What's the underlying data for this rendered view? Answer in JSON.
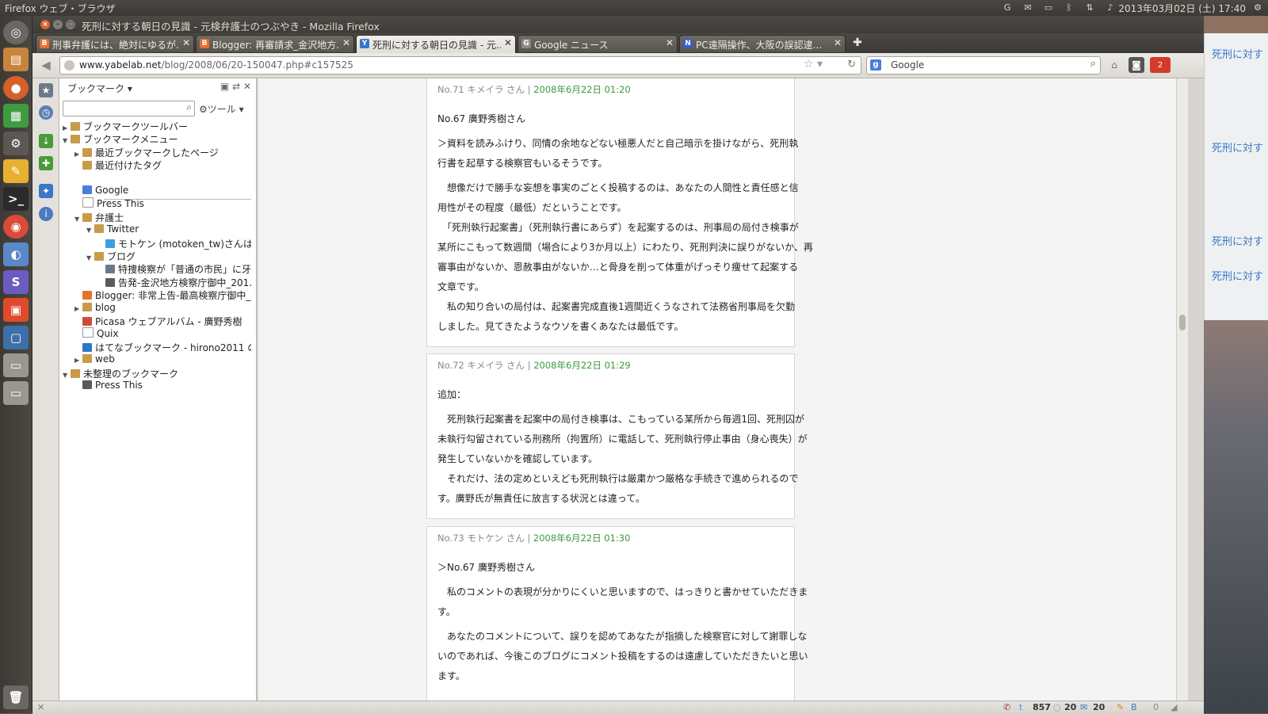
{
  "top_panel": {
    "app_name": "Firefox ウェブ・ブラウザ",
    "clock": "2013年03月02日 (土) 17:40"
  },
  "window": {
    "title": "死刑に対する朝日の見識 - 元検弁護士のつぶやき - Mozilla Firefox"
  },
  "tabs": [
    {
      "label": "刑事弁護には、絶対にゆるが...",
      "fav_color": "#e8702a",
      "fav": "B"
    },
    {
      "label": "Blogger: 再審請求_金沢地方...",
      "fav_color": "#e8702a",
      "fav": "B"
    },
    {
      "label": "死刑に対する朝日の見識 - 元...",
      "fav_color": "#3a77c8",
      "fav": "Y",
      "active": true
    },
    {
      "label": "Google ニュース",
      "fav_color": "#8a8a8a",
      "fav": "G"
    },
    {
      "label": "PC遠隔操作、大阪の誤認逮...",
      "fav_color": "#3a5fc8",
      "fav": "N"
    }
  ],
  "navbar": {
    "url_host": "www.yabelab.net",
    "url_path": "/blog/2008/06/20-150047.php#c157525",
    "search_value": "Google",
    "mail_badge": "2"
  },
  "sidebar": {
    "header": "ブックマーク",
    "tools_label": "ツール",
    "items": [
      {
        "label": "ブックマークツールバー",
        "twisty": "▶",
        "icon": "folder"
      },
      {
        "label": "ブックマークメニュー",
        "twisty": "▼",
        "icon": "folder"
      },
      {
        "label": "最近ブックマークしたページ",
        "twisty": "▶",
        "icon": "smartfolder"
      },
      {
        "label": "最近付けたタグ",
        "twisty": "",
        "icon": "smartfolder"
      },
      {
        "label": "Google",
        "twisty": "",
        "icon": "google"
      },
      {
        "label": "Press This",
        "twisty": "",
        "icon": "page"
      },
      {
        "label": "弁護士",
        "twisty": "▼",
        "icon": "folder"
      },
      {
        "label": "Twitter",
        "twisty": "▼",
        "icon": "folder"
      },
      {
        "label": "モトケン (motoken_tw)さんはT...",
        "twisty": "",
        "icon": "twitter"
      },
      {
        "label": "ブログ",
        "twisty": "▼",
        "icon": "folder"
      },
      {
        "label": "特捜検察が「普通の市民」に牙...",
        "twisty": "",
        "icon": "wordpress"
      },
      {
        "label": "告発-金沢地方検察庁御中_201...",
        "twisty": "",
        "icon": "image"
      },
      {
        "label": "Blogger: 非常上告-最高検察庁御中_...",
        "twisty": "",
        "icon": "blogger"
      },
      {
        "label": "blog",
        "twisty": "▶",
        "icon": "folder"
      },
      {
        "label": "Picasa ウェブアルバム - 廣野秀樹",
        "twisty": "",
        "icon": "picasa"
      },
      {
        "label": "Quix",
        "twisty": "",
        "icon": "page"
      },
      {
        "label": "はてなブックマーク - hirono2011 のブ...",
        "twisty": "",
        "icon": "hatena"
      },
      {
        "label": "web",
        "twisty": "▶",
        "icon": "folder"
      },
      {
        "label": "未整理のブックマーク",
        "twisty": "▼",
        "icon": "folder"
      },
      {
        "label": "Press This",
        "twisty": "",
        "icon": "image"
      }
    ]
  },
  "comments": [
    {
      "num": "No.71",
      "author": "キメイラ",
      "date": "2008年6月22日 01:20",
      "lines": [
        "No.67 廣野秀樹さん",
        "＞資料を読みふけり、同情の余地などない極悪人だと自己暗示を掛けながら、死刑執",
        "行書を起草する検察官もいるそうです。",
        "　想像だけで勝手な妄想を事実のごとく投稿するのは、あなたの人間性と責任感と信",
        "用性がその程度（最低）だということです。",
        "　「死刑執行起案書」（死刑執行書にあらず）を起案するのは、刑事局の局付き検事が",
        "某所にこもって数週間（場合により3か月以上）にわたり、死刑判決に誤りがないか、再",
        "審事由がないか、恩赦事由がないか…と骨身を削って体重がげっそり痩せて起案する",
        "文章です。",
        "　私の知り合いの局付は、起案書完成直後1週間近くうなされて法務省刑事局を欠勤",
        "しました。見てきたようなウソを書くあなたは最低です。"
      ]
    },
    {
      "num": "No.72",
      "author": "キメイラ",
      "date": "2008年6月22日 01:29",
      "lines": [
        "追加：",
        "　死刑執行起案書を起案中の局付き検事は、こもっている某所から毎週1回、死刑囚が",
        "未執行勾留されている刑務所（拘置所）に電話して、死刑執行停止事由（身心喪失）が",
        "発生していないかを確認しています。",
        "　それだけ、法の定めといえども死刑執行は厳粛かつ厳格な手続きで進められるので",
        "す。廣野氏が無責任に放言する状況とは違って。"
      ]
    },
    {
      "num": "No.73",
      "author": "モトケン",
      "date": "2008年6月22日 01:30",
      "lines": [
        "＞No.67 廣野秀樹さん",
        "　私のコメントの表現が分かりにくいと思いますので、はっきりと書かせていただきま",
        "す。",
        "　あなたのコメントについて、誤りを認めてあなたが指摘した検察官に対して謝罪しな",
        "いのであれば、今後このブログにコメント投稿をするのは遠慮していただきたいと思い",
        "ます。"
      ]
    }
  ],
  "comment_author_suffix": "さん",
  "desktop_note": [
    "死刑に対す",
    "死刑に対す",
    "死刑に対す",
    "死刑に対す"
  ],
  "statusbar": {
    "count1": "857",
    "count2": "20",
    "count3": "20",
    "misc": "0"
  }
}
